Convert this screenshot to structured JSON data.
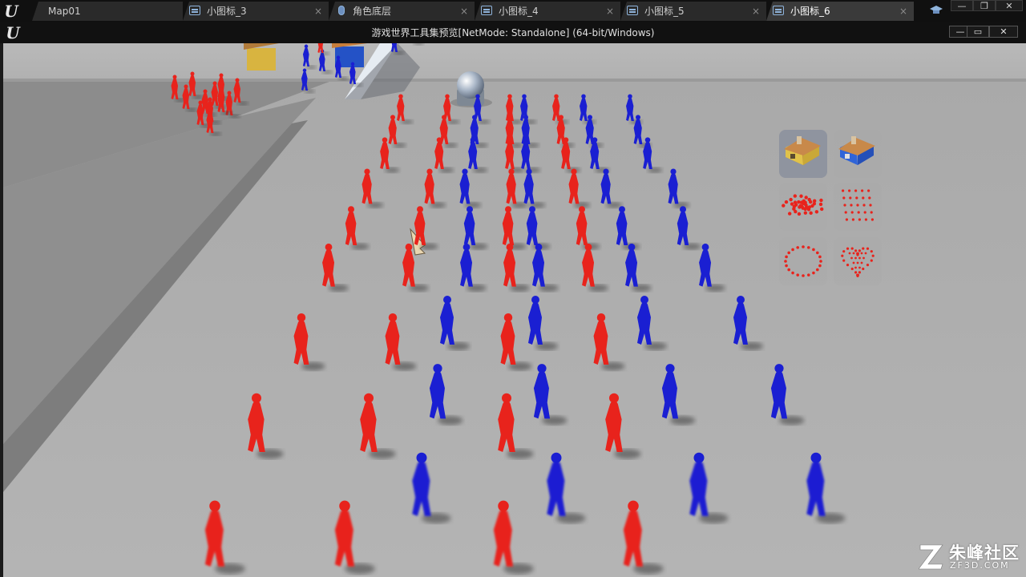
{
  "editor": {
    "tabs": [
      {
        "label": "Map01",
        "icon": "level-icon",
        "active": false
      },
      {
        "label": "小图标_3",
        "icon": "widget-blueprint-icon",
        "active": false
      },
      {
        "label": "角色底层",
        "icon": "blueprint-class-icon",
        "active": false
      },
      {
        "label": "小图标_4",
        "icon": "widget-blueprint-icon",
        "active": false
      },
      {
        "label": "小图标_5",
        "icon": "widget-blueprint-icon",
        "active": false
      },
      {
        "label": "小图标_6",
        "icon": "widget-blueprint-icon",
        "active": true
      }
    ],
    "tab_close_glyph": "×",
    "window_buttons": {
      "minimize": "—",
      "restore": "❐",
      "close": "✕"
    }
  },
  "game_window": {
    "title": "游戏世界工具集预览[NetMode: Standalone] (64-bit/Windows)",
    "buttons": {
      "minimize": "—",
      "maximize": "▭",
      "close": "✕"
    }
  },
  "toolbox": {
    "items": [
      {
        "name": "yellow-house-icon",
        "selected": true
      },
      {
        "name": "blue-house-icon",
        "selected": false
      },
      {
        "name": "crowd-cluster-icon",
        "selected": false
      },
      {
        "name": "grid-formation-icon",
        "selected": false
      },
      {
        "name": "circle-formation-icon",
        "selected": false
      },
      {
        "name": "heart-formation-icon",
        "selected": false
      }
    ]
  },
  "watermark": {
    "title": "朱峰社区",
    "subtitle": "ZF3D.COM"
  },
  "colors": {
    "red_team": "#e8231c",
    "blue_team": "#1a1fd2",
    "ground": "#a8a8a8",
    "tab_active": "#3a3a3a",
    "titlebar": "#111111"
  }
}
